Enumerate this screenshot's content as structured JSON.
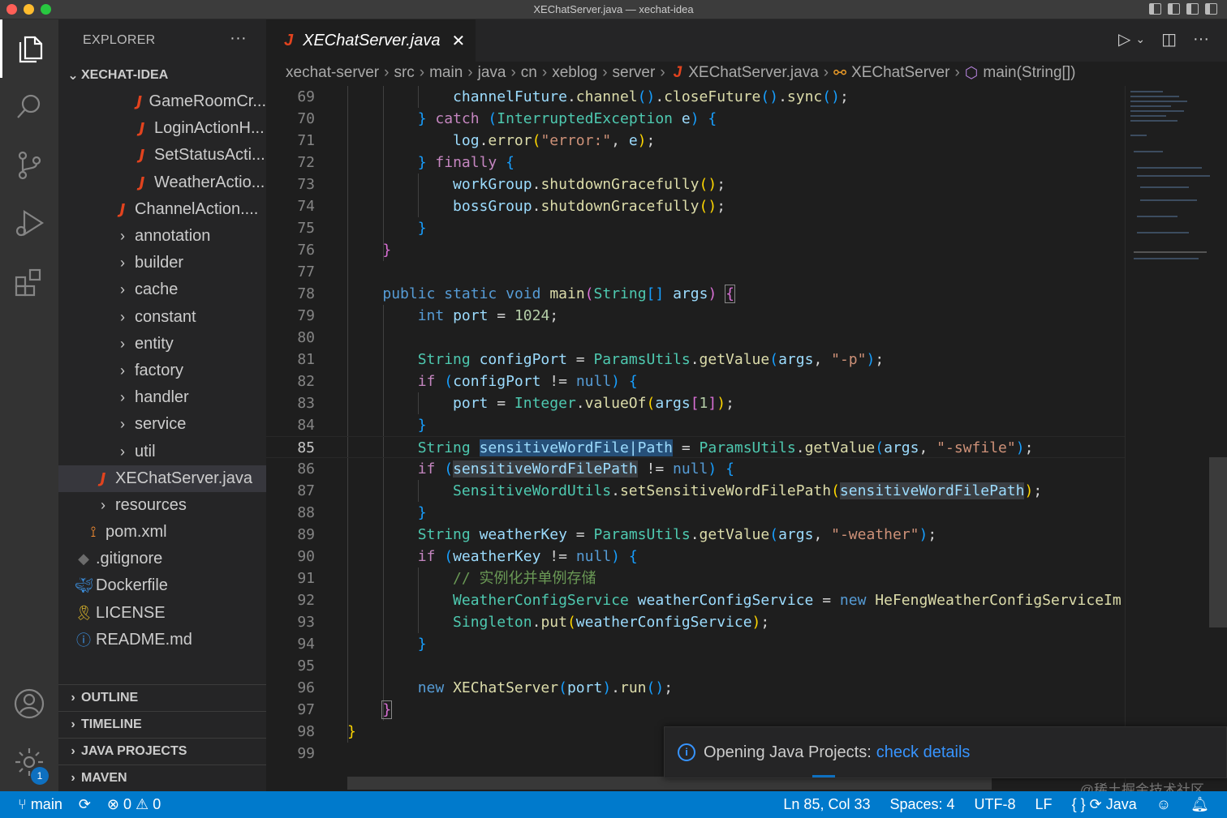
{
  "window": {
    "title": "XEChatServer.java — xechat-idea"
  },
  "sidebar": {
    "header": "EXPLORER",
    "more": "···",
    "project": "XECHAT-IDEA",
    "items": [
      {
        "label": "GameRoomCr...",
        "icon": "java-file-icon",
        "kind": "java",
        "depth": 3
      },
      {
        "label": "LoginActionH...",
        "icon": "java-file-icon",
        "kind": "java",
        "depth": 3
      },
      {
        "label": "SetStatusActi...",
        "icon": "java-file-icon",
        "kind": "java",
        "depth": 3
      },
      {
        "label": "WeatherActio...",
        "icon": "java-file-icon",
        "kind": "java",
        "depth": 3
      },
      {
        "label": "ChannelAction....",
        "icon": "java-file-icon",
        "kind": "java",
        "depth": 2
      },
      {
        "label": "annotation",
        "kind": "folder",
        "depth": 2
      },
      {
        "label": "builder",
        "kind": "folder",
        "depth": 2
      },
      {
        "label": "cache",
        "kind": "folder",
        "depth": 2
      },
      {
        "label": "constant",
        "kind": "folder",
        "depth": 2
      },
      {
        "label": "entity",
        "kind": "folder",
        "depth": 2
      },
      {
        "label": "factory",
        "kind": "folder",
        "depth": 2
      },
      {
        "label": "handler",
        "kind": "folder",
        "depth": 2
      },
      {
        "label": "service",
        "kind": "folder",
        "depth": 2
      },
      {
        "label": "util",
        "kind": "folder",
        "depth": 2
      },
      {
        "label": "XEChatServer.java",
        "kind": "java",
        "depth": 1,
        "selected": true
      },
      {
        "label": "resources",
        "kind": "folder",
        "depth": 1
      },
      {
        "label": "pom.xml",
        "kind": "rss",
        "depth": 0.5
      },
      {
        "label": ".gitignore",
        "kind": "git",
        "depth": 0
      },
      {
        "label": "Dockerfile",
        "kind": "docker",
        "depth": 0
      },
      {
        "label": "LICENSE",
        "kind": "lic",
        "depth": 0
      },
      {
        "label": "README.md",
        "kind": "info",
        "depth": 0
      }
    ],
    "sections": [
      "OUTLINE",
      "TIMELINE",
      "JAVA PROJECTS",
      "MAVEN"
    ]
  },
  "editor": {
    "tab": {
      "label": "XEChatServer.java",
      "close": "✕"
    },
    "breadcrumbs": [
      "xechat-server",
      "src",
      "main",
      "java",
      "cn",
      "xeblog",
      "server"
    ],
    "breadcrumb_file": "XEChatServer.java",
    "breadcrumb_class": "XEChatServer",
    "breadcrumb_method": "main(String[])",
    "current_line": 85
  },
  "notification": {
    "message": "Opening Java Projects:",
    "link": "check details"
  },
  "statusbar": {
    "branch": "main",
    "errors": "0",
    "warnings": "0",
    "position": "Ln 85, Col 33",
    "spaces": "Spaces: 4",
    "encoding": "UTF-8",
    "eol": "LF",
    "language": "Java",
    "notifications_badge": "1"
  },
  "watermark": "@稀土掘金技术社区"
}
